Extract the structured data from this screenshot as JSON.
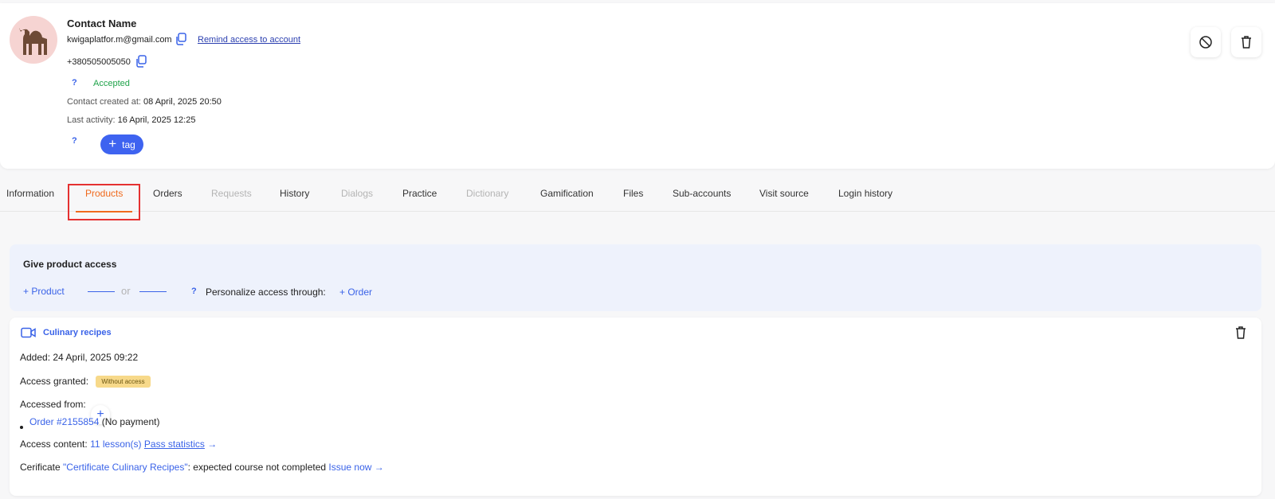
{
  "contact": {
    "name": "Contact Name",
    "email": "kwigaplatfor.m@gmail.com",
    "remind_link": "Remind access to account",
    "phone": "+380505005050",
    "help_mark": "?",
    "status": "Accepted",
    "created_label": "Contact created at:",
    "created_value": "08 April, 2025 20:50",
    "activity_label": "Last activity:",
    "activity_value": "16 April, 2025 12:25",
    "tag_button": "tag",
    "tag_plus": "+"
  },
  "tabs": [
    {
      "label": "Information",
      "state": "normal"
    },
    {
      "label": "Products",
      "state": "active"
    },
    {
      "label": "Orders",
      "state": "normal"
    },
    {
      "label": "Requests",
      "state": "disabled"
    },
    {
      "label": "History",
      "state": "normal"
    },
    {
      "label": "Dialogs",
      "state": "disabled"
    },
    {
      "label": "Practice",
      "state": "normal"
    },
    {
      "label": "Dictionary",
      "state": "disabled"
    },
    {
      "label": "Gamification",
      "state": "normal"
    },
    {
      "label": "Files",
      "state": "normal"
    },
    {
      "label": "Sub-accounts",
      "state": "normal"
    },
    {
      "label": "Visit source",
      "state": "normal"
    },
    {
      "label": "Login history",
      "state": "normal"
    }
  ],
  "access": {
    "title": "Give product access",
    "product_link": "+ Product",
    "or": "or",
    "help_mark": "?",
    "personalize": "Personalize access through:",
    "order_link": "+ Order"
  },
  "product": {
    "title": "Culinary recipes",
    "added": "Added: 24 April, 2025 09:22",
    "access_granted_label": "Access granted:",
    "access_badge": "Without access",
    "accessed_from_label": "Accessed from:",
    "plus": "+",
    "order_link": "Order #2155854",
    "order_note": "(No payment)",
    "access_content_label": "Access content:",
    "lessons_link": "11 lesson(s)",
    "pass_stats_link": "Pass statistics",
    "arrow": "→",
    "cert_prefix": "Cerificate",
    "cert_link": "\"Certificate Culinary Recipes\"",
    "cert_status": ": expected course not completed",
    "issue_link": "Issue now"
  },
  "colors": {
    "accent": "#3a63e8",
    "active_tab": "#f06a1d",
    "success": "#1fa34a",
    "badge_bg": "#f7d98a",
    "highlight": "#e53131"
  }
}
